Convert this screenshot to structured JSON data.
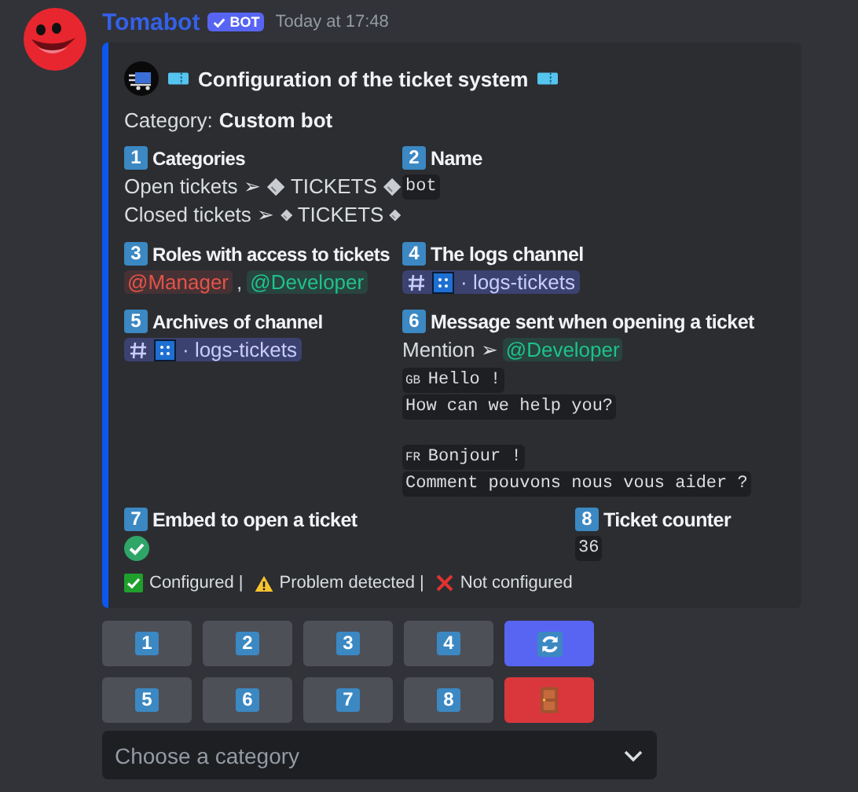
{
  "message": {
    "author": "Tomabot",
    "badge": "BOT",
    "timestamp": "Today at 17:48"
  },
  "embed": {
    "title": "Configuration of the ticket system",
    "category_label": "Category:",
    "category_value": "Custom bot",
    "fields": [
      {
        "number": "1",
        "name": "Categories",
        "kind": "categories",
        "lines": [
          {
            "label": "Open tickets ➢",
            "value": "TICKETS"
          },
          {
            "label": "Closed tickets ➢",
            "value": "TICKETS"
          }
        ]
      },
      {
        "number": "2",
        "name": "Name",
        "kind": "code",
        "value": "bot"
      },
      {
        "number": "3",
        "name": "Roles with access to tickets",
        "kind": "roles",
        "separator": ",",
        "roles": [
          {
            "name": "@Manager",
            "color": "#e5534b"
          },
          {
            "name": "@Developer",
            "color": "#1fc28a"
          }
        ]
      },
      {
        "number": "4",
        "name": "The logs channel",
        "kind": "channel",
        "value": "· logs-tickets"
      },
      {
        "number": "5",
        "name": "Archives of channel",
        "kind": "channel",
        "value": "· logs-tickets"
      },
      {
        "number": "6",
        "name": "Message sent when opening a ticket",
        "kind": "message",
        "mention_label": "Mention ➢",
        "mention": {
          "name": "@Developer",
          "color": "#1fc28a"
        },
        "blocks": [
          {
            "flag": "GB",
            "lines": [
              "Hello !",
              "How can we help you?"
            ]
          },
          {
            "flag": "FR",
            "lines": [
              "Bonjour !",
              "Comment pouvons nous vous aider ?"
            ]
          }
        ]
      },
      {
        "number": "7",
        "name": "Embed to open a ticket",
        "kind": "status",
        "configured": true
      },
      {
        "number": "8",
        "name": "Ticket counter",
        "kind": "code",
        "value": "36"
      }
    ],
    "legend": [
      {
        "kind": "configured",
        "label": "Configured |"
      },
      {
        "kind": "problem",
        "label": "Problem detected |"
      },
      {
        "kind": "not_configured",
        "label": "Not configured"
      }
    ]
  },
  "buttons": [
    {
      "kind": "number",
      "label": "1"
    },
    {
      "kind": "number",
      "label": "2"
    },
    {
      "kind": "number",
      "label": "3"
    },
    {
      "kind": "number",
      "label": "4"
    },
    {
      "kind": "refresh"
    },
    {
      "kind": "number",
      "label": "5"
    },
    {
      "kind": "number",
      "label": "6"
    },
    {
      "kind": "number",
      "label": "7"
    },
    {
      "kind": "number",
      "label": "8"
    },
    {
      "kind": "exit"
    }
  ],
  "select": {
    "placeholder": "Choose a category"
  }
}
